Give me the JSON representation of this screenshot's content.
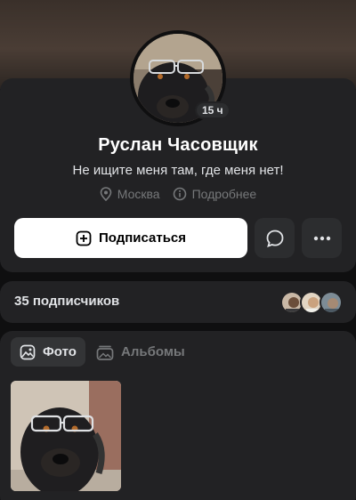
{
  "profile": {
    "name": "Руслан Часовщик",
    "status": "Не ищите меня там, где меня нет!",
    "online_badge": "15 ч",
    "location": "Москва",
    "details_link": "Подробнее"
  },
  "actions": {
    "subscribe_label": "Подписаться",
    "message_icon": "message-icon",
    "more_icon": "more-icon"
  },
  "followers": {
    "label": "35 подписчиков",
    "avatar_count": 3
  },
  "media": {
    "tabs": [
      {
        "label": "Фото",
        "icon": "photo-icon",
        "active": true
      },
      {
        "label": "Альбомы",
        "icon": "album-icon",
        "active": false
      }
    ]
  },
  "colors": {
    "background": "#0f0f10",
    "card": "#222224",
    "primary_button": "#ffffff",
    "secondary_text": "#76787a",
    "text": "#e1e3e6"
  }
}
